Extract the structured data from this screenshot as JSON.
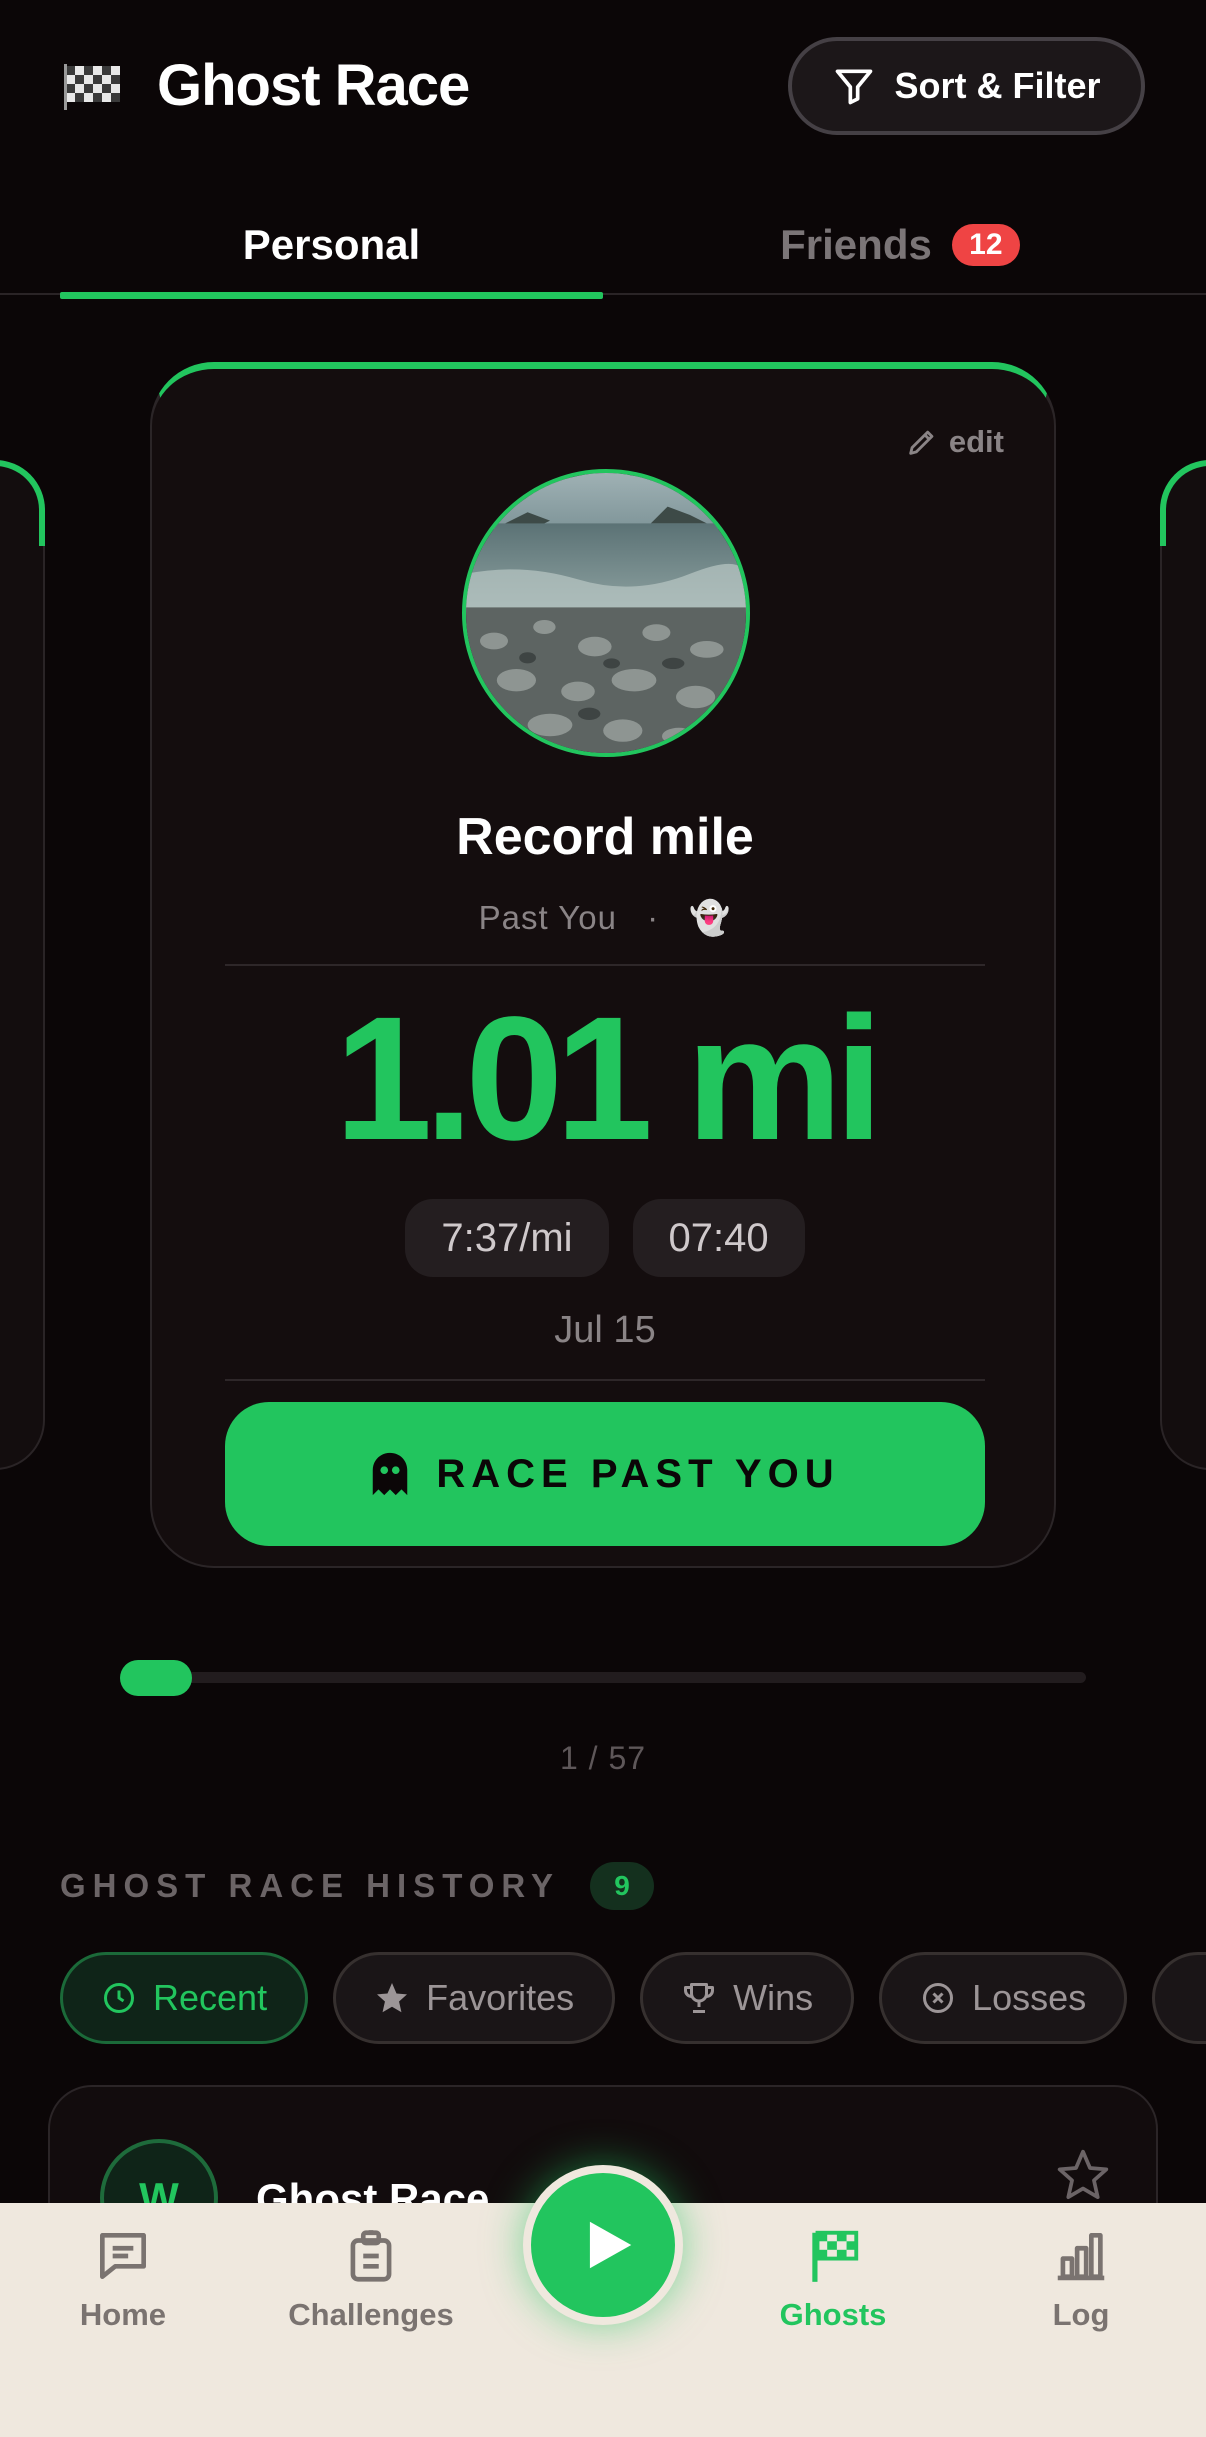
{
  "header": {
    "title": "Ghost Race",
    "sort_filter_label": "Sort & Filter"
  },
  "tabs": {
    "personal": "Personal",
    "friends": "Friends",
    "friends_badge": "12"
  },
  "ghost_card": {
    "edit_label": "edit",
    "title": "Record mile",
    "subtitle": "Past You",
    "subtitle_separator": "·",
    "subtitle_emoji": "👻",
    "distance": "1.01 mi",
    "pace": "7:37/mi",
    "duration": "07:40",
    "date": "Jul 15",
    "race_button": "RACE PAST YOU"
  },
  "carousel": {
    "position_text": "1 / 57",
    "current": 1,
    "total": 57
  },
  "history": {
    "title": "GHOST RACE HISTORY",
    "count": "9",
    "filters": [
      {
        "label": "Recent",
        "icon": "clock-icon",
        "active": true
      },
      {
        "label": "Favorites",
        "icon": "star-icon",
        "active": false
      },
      {
        "label": "Wins",
        "icon": "trophy-icon",
        "active": false
      },
      {
        "label": "Losses",
        "icon": "x-circle-icon",
        "active": false
      }
    ],
    "first_item": {
      "avatar_letter": "W",
      "title": "Ghost Race"
    }
  },
  "bottom_nav": {
    "items": [
      {
        "label": "Home",
        "icon": "chat-icon"
      },
      {
        "label": "Challenges",
        "icon": "clipboard-icon"
      },
      {
        "label": "Ghosts",
        "icon": "checkered-flag-icon",
        "active": true
      },
      {
        "label": "Log",
        "icon": "bar-chart-icon"
      }
    ],
    "center_action": "play-icon"
  },
  "colors": {
    "accent": "#22c55e",
    "background": "#0b0607",
    "card": "#140d0e",
    "badge": "#ef4444",
    "nav_background": "#efe8de"
  }
}
